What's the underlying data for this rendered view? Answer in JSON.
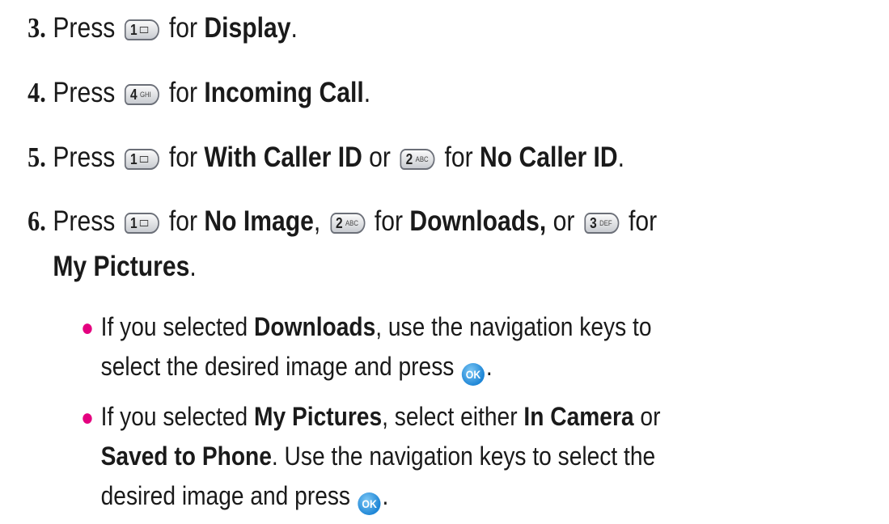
{
  "steps": [
    {
      "num": "3.",
      "a": "Press ",
      "key": {
        "digit": "1",
        "letters": ""
      },
      "b": " for ",
      "c": "Display",
      "d": "."
    },
    {
      "num": "4.",
      "a": "Press ",
      "key": {
        "digit": "4",
        "letters": "GHI"
      },
      "b": " for ",
      "c": "Incoming Call",
      "d": "."
    },
    {
      "num": "5.",
      "a": "Press ",
      "key": {
        "digit": "1",
        "letters": ""
      },
      "b": " for ",
      "c": "With Caller ID",
      "d": " or ",
      "key2": {
        "digit": "2",
        "letters": "ABC"
      },
      "e": " for ",
      "f": "No Caller ID",
      "g": "."
    },
    {
      "num": "6.",
      "a": "Press ",
      "key": {
        "digit": "1",
        "letters": ""
      },
      "b": " for ",
      "c": "No Image",
      "d": ", ",
      "key2": {
        "digit": "2",
        "letters": "ABC"
      },
      "e": " for ",
      "f": "Downloads,",
      "g": " or ",
      "key3": {
        "digit": "3",
        "letters": "DEF"
      },
      "h": " for",
      "i": "My Pictures",
      "j": "."
    }
  ],
  "bullets": [
    {
      "a": "If you selected ",
      "b": "Downloads",
      "c": ", use the navigation keys to",
      "d": "select the desired image and press ",
      "ok": "OK",
      "e": "."
    },
    {
      "a": "If you selected ",
      "b": "My Pictures",
      "c": ", select either ",
      "d": "In Camera",
      "e": " or",
      "f": "Saved to Phone",
      "g": ". Use the navigation keys to select the",
      "h": "desired image and press ",
      "ok": "OK",
      "i": "."
    }
  ],
  "colors": {
    "bullet": "#e4007f",
    "ok_button": "#1e86d6",
    "key_border": "#6b6f78"
  }
}
